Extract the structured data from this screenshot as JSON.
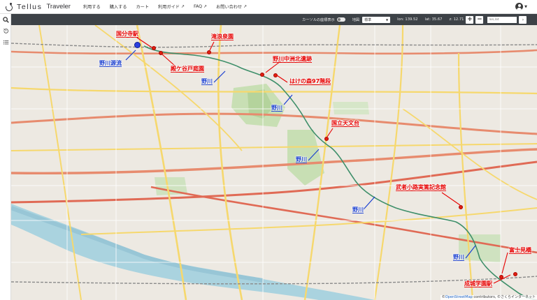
{
  "header": {
    "logo_text": "Tellus",
    "logo_sub": "Traveler",
    "nav": [
      {
        "label": "利用する",
        "external": false
      },
      {
        "label": "購入する",
        "external": false
      },
      {
        "label": "カート",
        "external": false
      },
      {
        "label": "利用ガイド",
        "external": true
      },
      {
        "label": "FAQ",
        "external": true
      },
      {
        "label": "お問い合わせ",
        "external": true
      }
    ],
    "external_icon": "↗"
  },
  "sidebar": {
    "icons": [
      "search-icon",
      "history-icon",
      "list-icon"
    ]
  },
  "toolbar": {
    "cursor_coords_label": "カーソルの座標表示",
    "map_label": "地図",
    "layer_value": "標準",
    "lon": "lon: 139.52",
    "lat": "lat: 35.67",
    "zoom": "z: 12.71",
    "zoom_in": "+",
    "zoom_out": "−",
    "lonlat_placeholder": "lon,lat",
    "go": "›"
  },
  "annotations": {
    "places": [
      "国分寺駅",
      "滝浪泉園",
      "殿ケ谷戸庭園",
      "野川中洲北遺跡",
      "はけの森97階段",
      "国立天文台",
      "武者小路実篤記念館",
      "富士見橋",
      "成城学園駅"
    ],
    "rivers": [
      "野川源流",
      "野川",
      "野川",
      "野川",
      "野川",
      "野川"
    ]
  },
  "attribution": {
    "prefix": "©",
    "osm": "OpenStreetMap",
    "rest": " contributors, ©さくらインターネット"
  },
  "colors": {
    "accent_red": "#e60000",
    "river_blue": "#1a3fd0",
    "toolbar": "#3d4247"
  }
}
